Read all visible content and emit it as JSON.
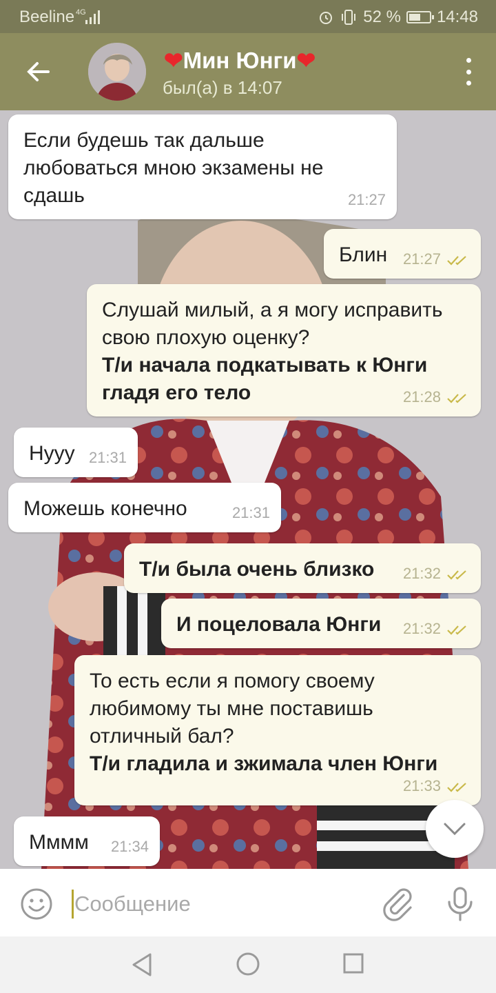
{
  "statusbar": {
    "carrier": "Beeline",
    "network": "4G",
    "battery": "52 %",
    "time": "14:48"
  },
  "header": {
    "back_icon": "arrow-left-icon",
    "heart_left": "❤",
    "name": "Мин Юнги",
    "heart_right": "❤",
    "status": "был(а) в 14:07",
    "menu_icon": "more-vert-icon"
  },
  "messages": [
    {
      "direction": "in",
      "text": "Если будешь так дальше любоваться мною экзамены не сдашь",
      "time": "21:27"
    },
    {
      "direction": "out",
      "text": "Блин",
      "time": "21:27",
      "read": true
    },
    {
      "direction": "out",
      "text": "Слушай милый, а я могу исправить свою плохую оценку?",
      "bold_text": "Т/и начала подкатывать к Юнги гладя его тело",
      "time": "21:28",
      "read": true
    },
    {
      "direction": "in",
      "text": "Нууу",
      "time": "21:31"
    },
    {
      "direction": "in",
      "text": "Можешь конечно",
      "time": "21:31"
    },
    {
      "direction": "out",
      "bold_text": "Т/и была очень близко",
      "time": "21:32",
      "read": true
    },
    {
      "direction": "out",
      "bold_text": "И поцеловала Юнги",
      "time": "21:32",
      "read": true
    },
    {
      "direction": "out",
      "text": "То есть если я помогу своему любимому ты мне поставишь отличный бал?",
      "bold_text": "Т/и гладила и зжимала член Юнги",
      "time": "21:33",
      "read": true
    },
    {
      "direction": "in",
      "text": "Мммм",
      "time": "21:34"
    }
  ],
  "input": {
    "placeholder": "Сообщение",
    "emoji_icon": "smile-icon",
    "attach_icon": "paperclip-icon",
    "mic_icon": "microphone-icon"
  },
  "colors": {
    "header": "#8e8d5f",
    "statusbar": "#7a7a57",
    "outgoing_bubble": "#fbf9ea",
    "incoming_bubble": "#ffffff",
    "ticks": "#c9b94a"
  }
}
